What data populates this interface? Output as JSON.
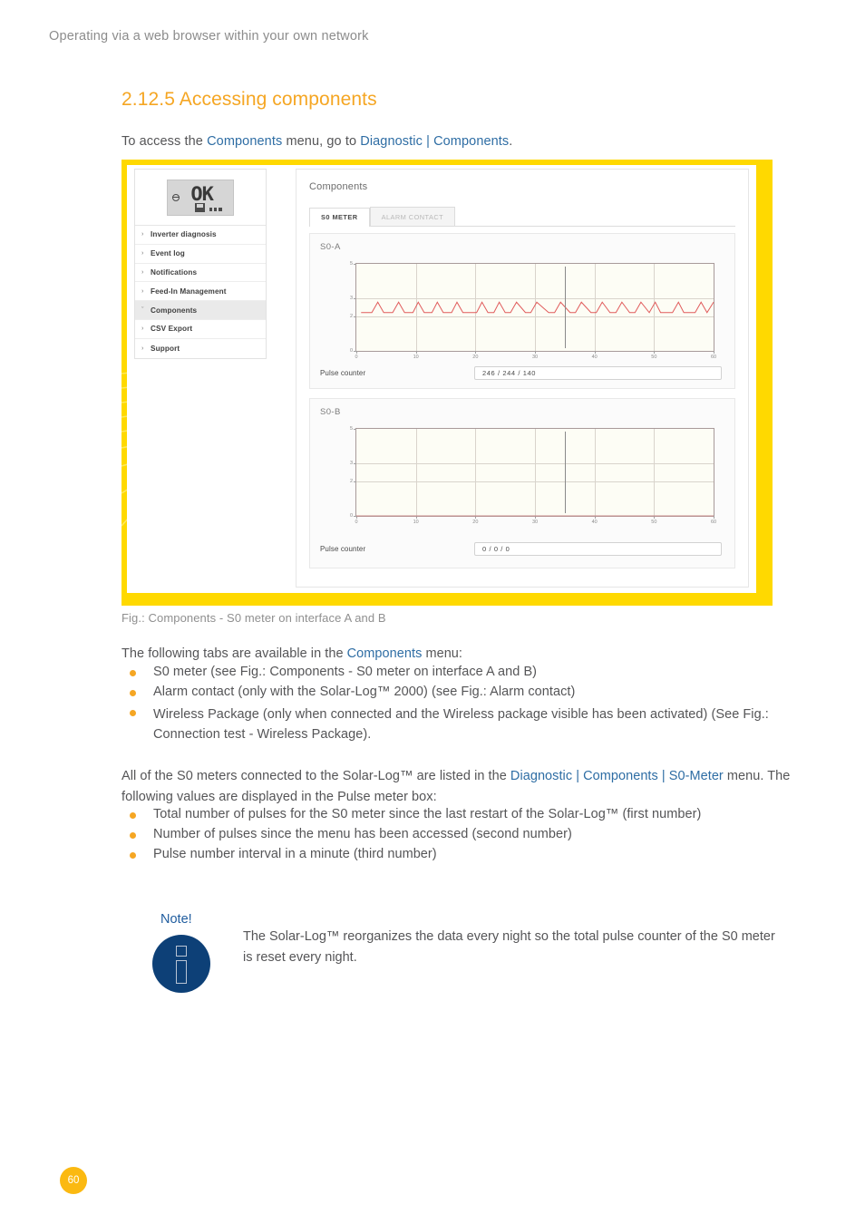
{
  "running_header": "Operating via a web browser within your own network",
  "section": {
    "heading": "2.12.5 Accessing components",
    "intro_pre": "To access the ",
    "intro_link1": "Components",
    "intro_mid": " menu, go to ",
    "intro_link2": "Diagnostic | Components",
    "intro_post": "."
  },
  "figure": {
    "caption": "Fig.: Components - S0 meter on interface A and B",
    "lcd_text": "OK",
    "sidebar": {
      "items": [
        {
          "label": "Inverter diagnosis",
          "chevron": "›",
          "active": false
        },
        {
          "label": "Event log",
          "chevron": "›",
          "active": false
        },
        {
          "label": "Notifications",
          "chevron": "›",
          "active": false
        },
        {
          "label": "Feed-In Management",
          "chevron": "›",
          "active": false
        },
        {
          "label": "Components",
          "chevron": "ˇ",
          "active": true
        },
        {
          "label": "CSV Export",
          "chevron": "›",
          "active": false
        },
        {
          "label": "Support",
          "chevron": "›",
          "active": false
        }
      ]
    },
    "panel": {
      "title": "Components",
      "tabs": [
        {
          "label": "S0 METER",
          "selected": true
        },
        {
          "label": "ALARM CONTACT",
          "selected": false
        }
      ],
      "pulse_counter_label": "Pulse counter",
      "blocks": [
        {
          "label": "S0-A",
          "pulse_counter_value": "246 / 244 / 140"
        },
        {
          "label": "S0-B",
          "pulse_counter_value": "0 / 0 / 0"
        }
      ]
    }
  },
  "chart_data": [
    {
      "type": "line",
      "title": "S0-A",
      "xlabel": "",
      "ylabel": "",
      "xlim": [
        0,
        60
      ],
      "ylim": [
        0,
        5
      ],
      "ytick_labels": [
        "5",
        "3",
        "2",
        "0"
      ],
      "ytick_values": [
        5,
        3,
        2,
        0
      ],
      "xtick_labels": [
        "0",
        "10",
        "20",
        "30",
        "40",
        "50",
        "60"
      ],
      "xtick_values": [
        0,
        10,
        20,
        30,
        40,
        50,
        60
      ],
      "grid": true,
      "line_color": "#e05b5b",
      "baseline": 2.2,
      "peak": 2.8,
      "cursor_x": 35,
      "series": [
        {
          "name": "S0-A pulses",
          "x": [
            0.8,
            2.6,
            3.6,
            4.6,
            6.1,
            7.1,
            8.1,
            9.5,
            10.4,
            11.4,
            12.7,
            13.6,
            14.6,
            16.0,
            16.9,
            17.9,
            20.2,
            21.1,
            22.1,
            23.1,
            24.0,
            25.0,
            25.9,
            26.9,
            28.4,
            29.3,
            30.3,
            32.3,
            33.3,
            34.3,
            35.9,
            36.8,
            37.8,
            39.4,
            40.3,
            41.3,
            42.6,
            43.6,
            44.6,
            45.9,
            46.8,
            47.8,
            49.2,
            50.2,
            51.1,
            53.1,
            54.1,
            55.0,
            56.9,
            57.9,
            58.9,
            60.0
          ],
          "y": [
            2.2,
            2.2,
            2.8,
            2.2,
            2.2,
            2.8,
            2.2,
            2.2,
            2.8,
            2.2,
            2.2,
            2.8,
            2.2,
            2.2,
            2.8,
            2.2,
            2.2,
            2.8,
            2.2,
            2.2,
            2.8,
            2.2,
            2.2,
            2.8,
            2.2,
            2.2,
            2.8,
            2.2,
            2.2,
            2.8,
            2.2,
            2.2,
            2.8,
            2.2,
            2.2,
            2.8,
            2.2,
            2.2,
            2.8,
            2.2,
            2.2,
            2.8,
            2.2,
            2.8,
            2.2,
            2.2,
            2.8,
            2.2,
            2.2,
            2.8,
            2.2,
            2.8
          ]
        }
      ]
    },
    {
      "type": "line",
      "title": "S0-B",
      "xlabel": "",
      "ylabel": "",
      "xlim": [
        0,
        60
      ],
      "ylim": [
        0,
        5
      ],
      "ytick_labels": [
        "5",
        "3",
        "2",
        "0"
      ],
      "ytick_values": [
        5,
        3,
        2,
        0
      ],
      "xtick_labels": [
        "0",
        "10",
        "20",
        "30",
        "40",
        "50",
        "60"
      ],
      "xtick_values": [
        0,
        10,
        20,
        30,
        40,
        50,
        60
      ],
      "grid": true,
      "line_color": "#c98a8a",
      "baseline": 0,
      "peak": 0,
      "cursor_x": 35,
      "series": [
        {
          "name": "S0-B pulses",
          "x": [
            0,
            60
          ],
          "y": [
            0,
            0
          ]
        }
      ]
    }
  ],
  "body": {
    "tabs_intro_pre": "The following tabs are available in the ",
    "tabs_intro_link": "Components",
    "tabs_intro_post": " menu:",
    "tab_bullets": [
      "S0 meter (see Fig.: Components - S0 meter on interface A and B)",
      "Alarm contact (only with the Solar-Log™ 2000) (see Fig.: Alarm contact)",
      "Wireless Package (only when connected and the Wireless package visible has been activated) (See Fig.: Connection test - Wireless Package)."
    ],
    "meters_para_pre": "All of the S0 meters connected to the Solar-Log™ are listed in the ",
    "meters_para_link": "Diagnostic | Components | S0-Meter",
    "meters_para_post": " menu. The following values are displayed in the Pulse meter box:",
    "value_bullets": [
      "Total number of pulses for the S0 meter since the last restart of the Solar-Log™ (first number)",
      "Number of pulses since the menu has been accessed (second number)",
      "Pulse number interval in a minute (third number)"
    ]
  },
  "note": {
    "title": "Note!",
    "text": "The Solar-Log™ reorganizes the data every night so the total pulse counter of the S0 meter is reset every night."
  },
  "footer": {
    "page_number": "60"
  },
  "colors": {
    "accent_yellow": "#ffd900",
    "heading_orange": "#f5a623",
    "link_blue": "#2e6da4",
    "note_blue": "#0d4077",
    "page_badge": "#fbb911",
    "chart_line_a": "#e05b5b"
  }
}
